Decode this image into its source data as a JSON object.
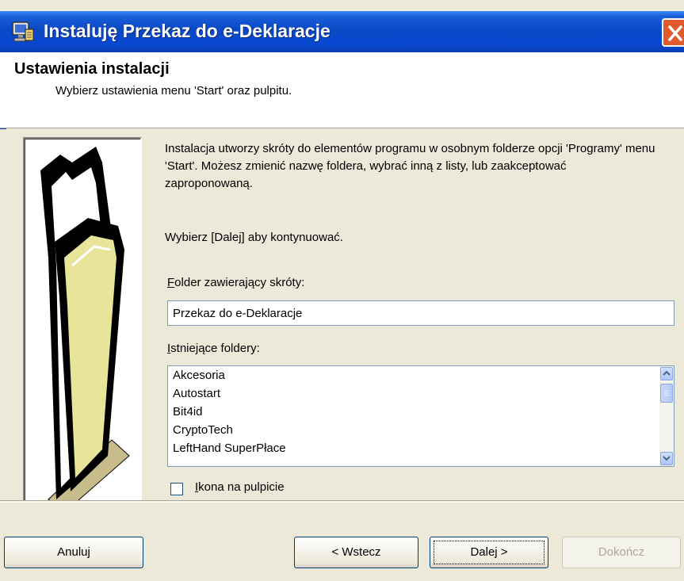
{
  "window": {
    "title": "Instaluję Przekaz do e-Deklaracje",
    "title_icon": "installer-computer-icon",
    "close_icon": "close-icon"
  },
  "header": {
    "title": "Ustawienia instalacji",
    "subtitle": "Wybierz ustawienia menu 'Start' oraz pulpitu."
  },
  "main": {
    "illustration_icon": "folder-illustration",
    "description": "Instalacja utworzy skróty do elementów programu w osobnym folderze opcji 'Programy' menu 'Start'. Możesz zmienić nazwę foldera, wybrać inną z listy, lub zaakceptować zaproponowaną.",
    "continue_text": "Wybierz [Dalej] aby kontynuować.",
    "folder_label_first": "F",
    "folder_label_rest": "older zawierający skróty:",
    "folder_value": "Przekaz do e-Deklaracje",
    "existing_label_first": "I",
    "existing_label_rest": "stniejące foldery:",
    "existing_folders": [
      "Akcesoria",
      "Autostart",
      "Bit4id",
      "CryptoTech",
      "LeftHand SuperPłace"
    ],
    "desktop_checkbox_checked": false,
    "desktop_label_first": "I",
    "desktop_label_rest": "kona na pulpicie"
  },
  "footer": {
    "cancel": "Anuluj",
    "back": "< Wstecz",
    "next_first": "Dalej",
    "next_suffix": " >",
    "finish": "Dokończ"
  },
  "colors": {
    "titlebar": "#0848d0",
    "dialog": "#ece9d8",
    "illustration_folder": "#e8e49a",
    "close_button": "#e25a2c"
  }
}
